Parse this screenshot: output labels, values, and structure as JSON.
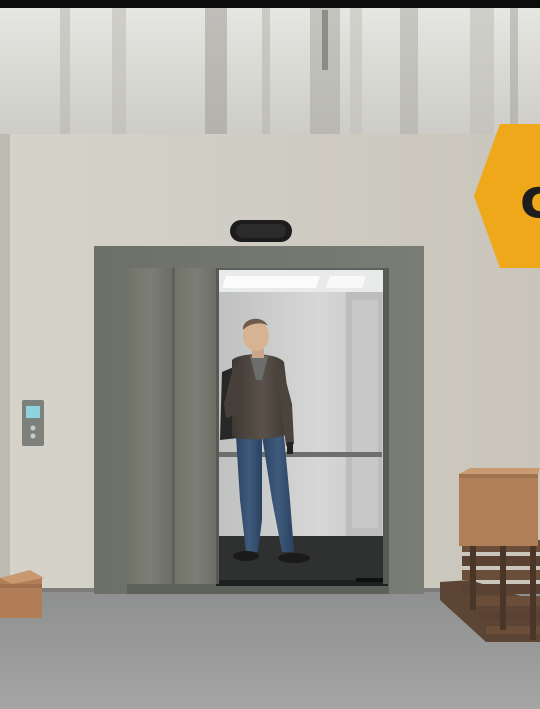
{
  "badge": {
    "text": "c"
  }
}
